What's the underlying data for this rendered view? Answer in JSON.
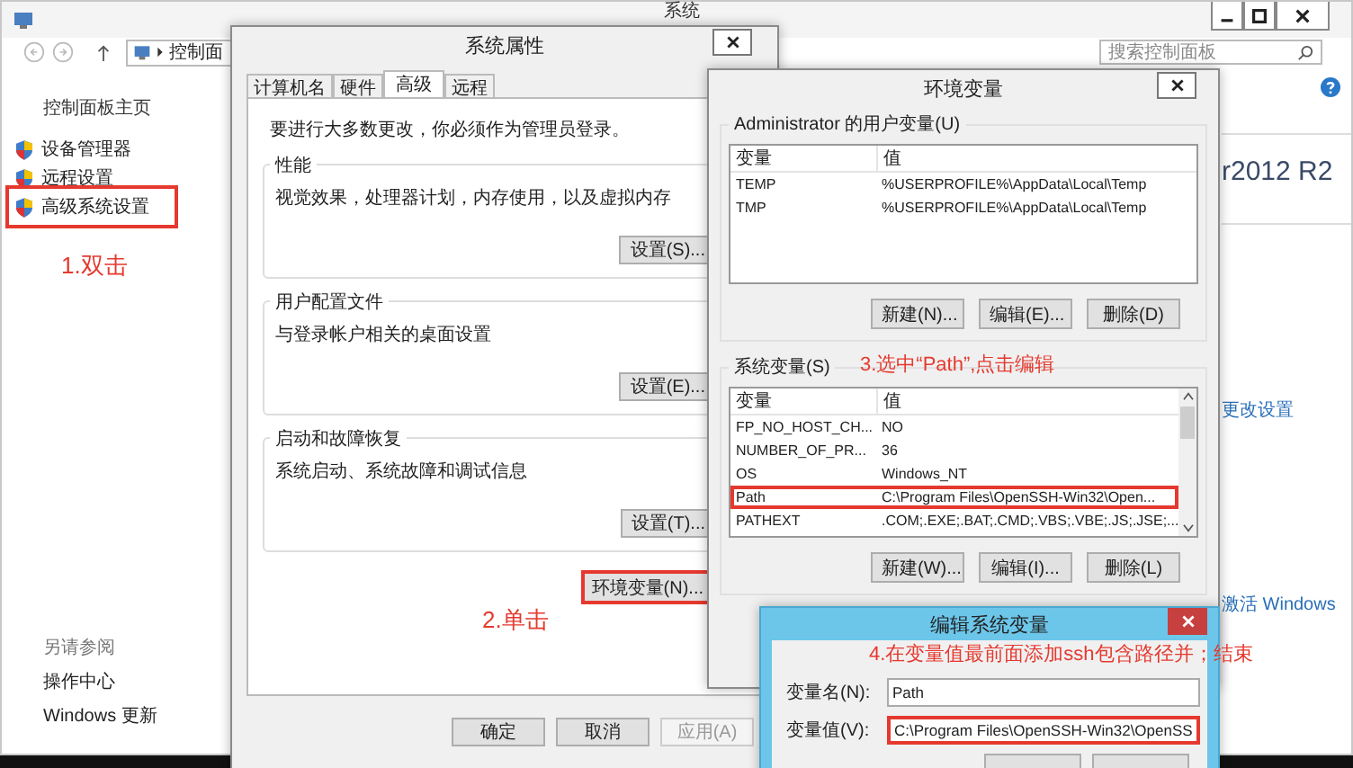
{
  "control_panel": {
    "title": "系统",
    "address": "控制面",
    "search_placeholder": "搜索控制面板",
    "home_link": "控制面板主页",
    "links": [
      {
        "label": "设备管理器",
        "highlighted": false
      },
      {
        "label": "远程设置",
        "highlighted": false
      },
      {
        "label": "高级系统设置",
        "highlighted": true
      }
    ],
    "edition": "r2012 R2",
    "change_settings": "更改设置",
    "activate": "激活 Windows",
    "see_also_title": "另请参阅",
    "see_also": [
      "操作中心",
      "Windows 更新"
    ]
  },
  "system_properties": {
    "title": "系统属性",
    "tabs": [
      {
        "label": "计算机名",
        "selected": false
      },
      {
        "label": "硬件",
        "selected": false
      },
      {
        "label": "高级",
        "selected": true
      },
      {
        "label": "远程",
        "selected": false
      }
    ],
    "notice": "要进行大多数更改，你必须作为管理员登录。",
    "groups": [
      {
        "title": "性能",
        "description": "视觉效果，处理器计划，内存使用，以及虚拟内存",
        "button": "设置(S)..."
      },
      {
        "title": "用户配置文件",
        "description": "与登录帐户相关的桌面设置",
        "button": "设置(E)..."
      },
      {
        "title": "启动和故障恢复",
        "description": "系统启动、系统故障和调试信息",
        "button": "设置(T)..."
      }
    ],
    "env_button": {
      "label": "环境变量(N)...",
      "highlighted": true
    },
    "buttons": [
      {
        "label": "确定",
        "disabled": false
      },
      {
        "label": "取消",
        "disabled": false
      },
      {
        "label": "应用(A)",
        "disabled": true
      }
    ]
  },
  "env_vars": {
    "title": "环境变量",
    "user_section": "Administrator 的用户变量(U)",
    "columns": [
      "变量",
      "值"
    ],
    "user_rows": [
      {
        "name": "TEMP",
        "value": "%USERPROFILE%\\AppData\\Local\\Temp"
      },
      {
        "name": "TMP",
        "value": "%USERPROFILE%\\AppData\\Local\\Temp"
      }
    ],
    "user_buttons": [
      "新建(N)...",
      "编辑(E)...",
      "删除(D)"
    ],
    "system_section": "系统变量(S)",
    "system_columns": [
      "变量",
      "值"
    ],
    "system_rows": [
      {
        "name": "FP_NO_HOST_CH...",
        "value": "NO",
        "highlighted": false
      },
      {
        "name": "NUMBER_OF_PR...",
        "value": "36",
        "highlighted": false
      },
      {
        "name": "OS",
        "value": "Windows_NT",
        "highlighted": false
      },
      {
        "name": "Path",
        "value": "C:\\Program Files\\OpenSSH-Win32\\Open...",
        "highlighted": true
      },
      {
        "name": "PATHEXT",
        "value": ".COM;.EXE;.BAT;.CMD;.VBS;.VBE;.JS;.JSE;...",
        "highlighted": false
      }
    ],
    "system_buttons": [
      "新建(W)...",
      "编辑(I)...",
      "删除(L)"
    ]
  },
  "edit_dialog": {
    "title": "编辑系统变量",
    "name_label": "变量名(N):",
    "name_value": "Path",
    "value_label": "变量值(V):",
    "value_value": "C:\\Program Files\\OpenSSH-Win32\\OpenSS",
    "value_highlighted": true
  },
  "annotations": [
    "1.双击",
    "2.单击",
    "3.选中“Path”,点击编辑",
    "4.在变量值最前面添加ssh包含路径并；结束"
  ]
}
